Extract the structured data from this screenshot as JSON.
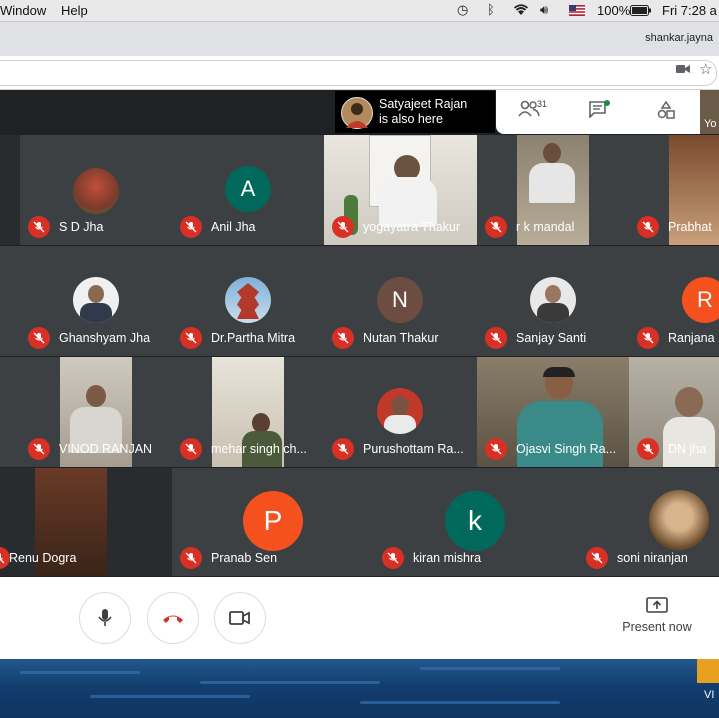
{
  "menubar": {
    "items": [
      "Window",
      "Help"
    ],
    "battery": "100%",
    "clock": "Fri 7:28 a"
  },
  "browser": {
    "profile": "shankar.jayna"
  },
  "notice": {
    "line1": "Satyajeet Rajan",
    "line2": "is also here"
  },
  "topbar": {
    "participants_count": "31",
    "right_label": "Yo"
  },
  "participants": [
    {
      "name": "S D Jha"
    },
    {
      "name": "Anil Jha",
      "initial": "A"
    },
    {
      "name": "yogayatra Thakur"
    },
    {
      "name": "r k mandal"
    },
    {
      "name": "Prabhat"
    },
    {
      "name": "Ghanshyam Jha"
    },
    {
      "name": "Dr.Partha Mitra"
    },
    {
      "name": "Nutan Thakur",
      "initial": "N"
    },
    {
      "name": "Sanjay Santi"
    },
    {
      "name": "Ranjana",
      "initial": "R"
    },
    {
      "name": "VINOD RANJAN"
    },
    {
      "name": "mehar singh ch..."
    },
    {
      "name": "Purushottam Ra..."
    },
    {
      "name": "Ojasvi Singh Ra..."
    },
    {
      "name": "DN jha"
    },
    {
      "name": "Renu Dogra"
    },
    {
      "name": "Pranab Sen",
      "initial": "P"
    },
    {
      "name": "kiran mishra",
      "initial": "k"
    },
    {
      "name": "soni niranjan"
    }
  ],
  "controls": {
    "present_label": "Present now"
  },
  "colors": {
    "meet_bg": "#202124",
    "tile_bg": "#3c4043",
    "mute_red": "#d93025",
    "avatar_green": "#00695c",
    "avatar_brown": "#6d4c41",
    "avatar_orange": "#f4511e"
  },
  "desktop_label": "VI"
}
